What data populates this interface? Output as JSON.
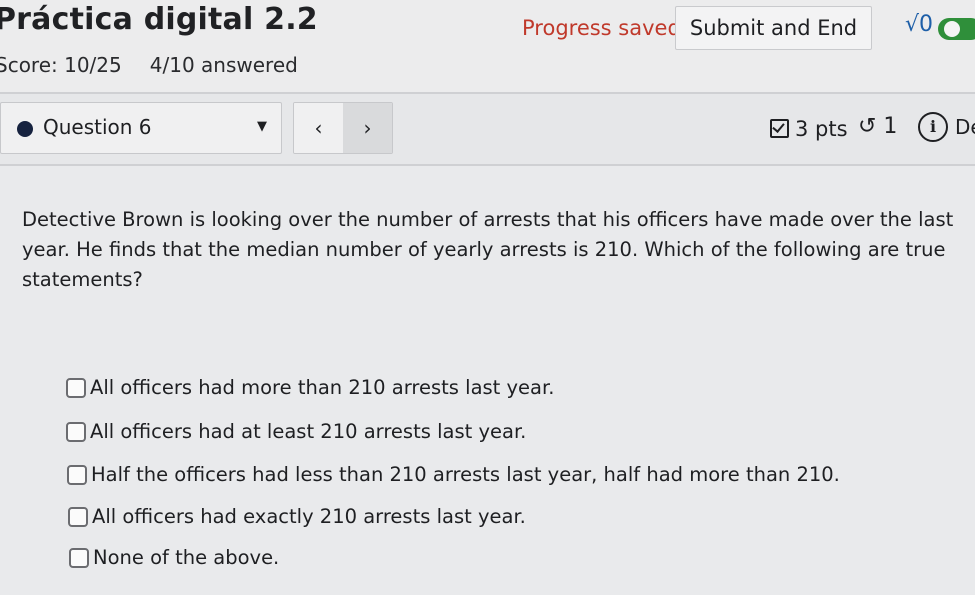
{
  "header": {
    "title": "Práctica digital 2.2",
    "score": "Score: 10/25",
    "answered": "4/10 answered",
    "progress_status": "Progress saved",
    "submit_label": "Submit and End",
    "math_icon_glyph": "√0",
    "accent_color": "#c0392b",
    "toggle_color": "#2f8f3a"
  },
  "question_bar": {
    "question_label": "Question 6",
    "prev_glyph": "‹",
    "next_glyph": "›",
    "points": "3 pts",
    "retry_count": "↺ 1",
    "info_glyph": "i",
    "details_label": "De"
  },
  "question": {
    "text": "Detective Brown is looking over the number of arrests that his officers have made over the last year. He finds that the median number of yearly arrests is 210. Which of the following are true statements?",
    "options": [
      {
        "label": "All officers had more than 210 arrests last year.",
        "checked": false
      },
      {
        "label": "All officers had at least 210 arrests last year.",
        "checked": false
      },
      {
        "label": "Half the officers had less than 210 arrests last year, half had more than 210.",
        "checked": false
      },
      {
        "label": "All officers had exactly 210 arrests last year.",
        "checked": false
      },
      {
        "label": "None of the above.",
        "checked": false
      }
    ]
  }
}
